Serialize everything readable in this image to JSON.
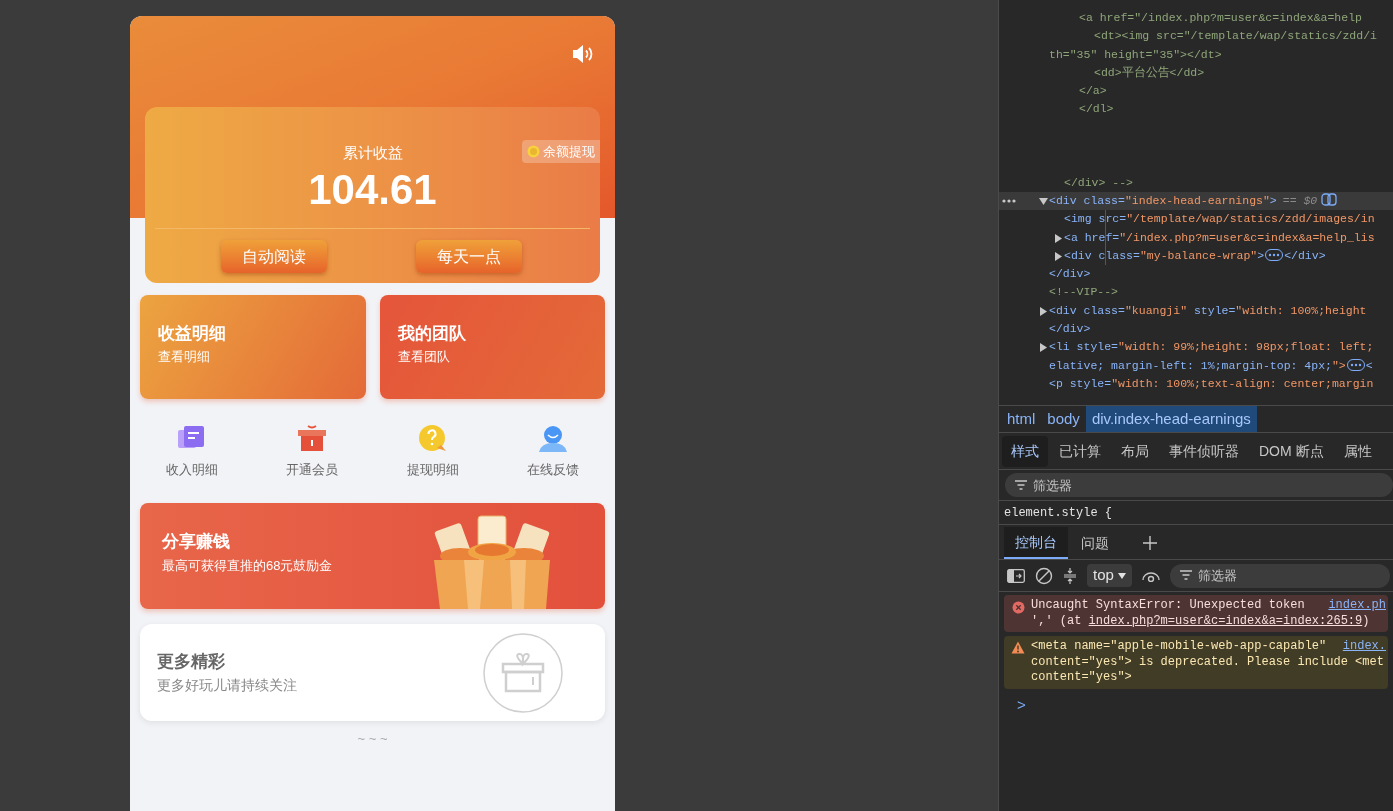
{
  "phone": {
    "earnings": {
      "label": "累计收益",
      "amount": "104.61",
      "withdraw": "余额提现",
      "buttons": [
        "自动阅读",
        "每天一点"
      ]
    },
    "feature_cards": [
      {
        "title": "收益明细",
        "subtitle": "查看明细",
        "color": "#eca440"
      },
      {
        "title": "我的团队",
        "subtitle": "查看团队",
        "color": "#e5553a"
      }
    ],
    "shortcuts": [
      {
        "label": "收入明细"
      },
      {
        "label": "开通会员"
      },
      {
        "label": "提现明细"
      },
      {
        "label": "在线反馈"
      }
    ],
    "banner": {
      "title": "分享赚钱",
      "subtitle": "最高可获得直推的68元鼓励金"
    },
    "more_card": {
      "title": "更多精彩",
      "subtitle": "更多好玩儿请持续关注"
    },
    "footer": "~ ~ ~"
  },
  "devtools": {
    "elements": [
      {
        "children": [
          {
            "children": [
              {
                "kind": "comment",
                "text": "<a href=\"/index.php?m=user&c=index&a=help",
                "children": [
                  {
                    "kind": "comment",
                    "text": "<dt><img src=\"/template/wap/statics/zdd/i",
                    "continuation": "th=\"35\" height=\"35\"></dt>"
                  },
                  {
                    "kind": "comment",
                    "text": "<dd>平台公告</dd>"
                  }
                ]
              },
              {
                "kind": "comment",
                "text": "</a>"
              },
              {
                "kind": "comment",
                "text": "</dl>"
              }
            ]
          },
          {
            "kind": "comment",
            "text": "</div> -->"
          }
        ]
      },
      {
        "kind": "tag",
        "text": "<div class=\"index-head-earnings\">",
        "selected": true,
        "selection_note": "== $0",
        "expanded": true,
        "children": [
          {
            "kind": "tag",
            "text": "<img src=\"/template/wap/statics/zdd/images/in"
          },
          {
            "kind": "tag",
            "text": "<a href=\"/index.php?m=user&c=index&a=help_lis",
            "expanded": false
          },
          {
            "kind": "tag",
            "text": "<div class=\"my-balance-wrap\">",
            "after": "</div>",
            "expanded": false
          }
        ]
      },
      {
        "kind": "tag",
        "text": "</div>"
      },
      {
        "kind": "comment",
        "text": "<!--VIP-->"
      },
      {
        "kind": "tag",
        "text": "<div class=\"kuangji\" style=\"width: 100%;height",
        "expanded": false
      },
      {
        "kind": "tag",
        "text": "</div>"
      },
      {
        "kind": "tag",
        "text": "<li style=\"width: 99%;height: 98px;float: left;",
        "continuation": "elative; margin-left: 1%;margin-top: 4px;\">",
        "after": "<",
        "expanded": false
      },
      {
        "kind": "tag",
        "text": "<p style=\"width: 100%;text-align: center;margin"
      }
    ],
    "breadcrumbs": [
      {
        "label": "html",
        "selected": false
      },
      {
        "label": "body",
        "selected": false
      },
      {
        "label": "div.index-head-earnings",
        "selected": true
      }
    ],
    "style_tabs": [
      {
        "label": "样式",
        "selected": true
      },
      {
        "label": "已计算",
        "selected": false
      },
      {
        "label": "布局",
        "selected": false
      },
      {
        "label": "事件侦听器",
        "selected": false
      },
      {
        "label": "DOM 断点",
        "selected": false
      },
      {
        "label": "属性",
        "selected": false
      }
    ],
    "styles_filter": {
      "placeholder": "筛选器"
    },
    "style_rule": "element.style {",
    "drawer_tabs": [
      {
        "label": "控制台",
        "selected": true
      },
      {
        "label": "问题",
        "selected": false
      }
    ],
    "context": "top",
    "console_filter": {
      "placeholder": "筛选器"
    },
    "messages": [
      {
        "kind": "error",
        "source": "index.ph",
        "lines": [
          [
            {
              "text": "Uncaught SyntaxError: Unexpected token"
            }
          ],
          [
            {
              "text": "',' (at "
            },
            {
              "link": "index.php?m=user&c=index&a=index:265:9"
            },
            {
              "text": ")"
            }
          ]
        ]
      },
      {
        "kind": "warning",
        "source": "index.",
        "lines": [
          [
            {
              "text": "<meta name=\"apple-mobile-web-app-capable\""
            }
          ],
          [
            {
              "text": "content=\"yes\"> is deprecated. Please include <met"
            }
          ],
          [
            {
              "text": "content=\"yes\">"
            }
          ]
        ]
      }
    ],
    "prompt": ">"
  }
}
